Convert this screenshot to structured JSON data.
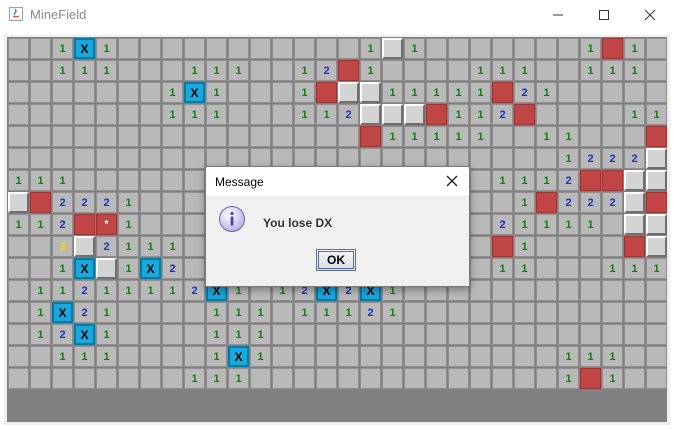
{
  "window": {
    "title": "MineField",
    "minimize_icon": "minimize-icon",
    "maximize_icon": "maximize-icon",
    "close_icon": "close-icon"
  },
  "dialog": {
    "title": "Message",
    "message": "You lose DX",
    "ok_label": "OK",
    "icon": "info-icon"
  },
  "board": {
    "rows": 18,
    "cols": 30,
    "grid": [
      "..1F1...........1R1.......1M1.",
      "..111...111..12M1....111..111.",
      ".......1F1...1MRR11111M21.....",
      ".......111...112RRRM112M....11",
      "................M11111..11...M",
      ".........................1222R",
      "111...................1112MMRR",
      "RM2221.................1M222RM",
      "112M*1................21111.RR",
      "..3R2111..............M1....MR",
      "..1FR1F2......F2211...11...111",
      ".11211112F1.12F2F1............",
      ".1F21....111.11121............",
      ".12F1....111..................",
      "..111....1F1.............111..",
      "........111..............1M1.."
    ],
    "legend": {
      "1": "number-1",
      "2": "number-2",
      "3": "number-3",
      "F": "flag-x",
      "M": "mine",
      "R": "revealed-empty",
      "*": "exploded-mine",
      ".": "hidden"
    },
    "colors": {
      "hidden": "#b9b9b9",
      "one": "#127d12",
      "two": "#1632c8",
      "three": "#f1e000",
      "mine": "#c04545",
      "flag": "#19a8dc",
      "revealed": "#d4d4d4"
    },
    "flag_text": "X",
    "star_text": "*"
  }
}
